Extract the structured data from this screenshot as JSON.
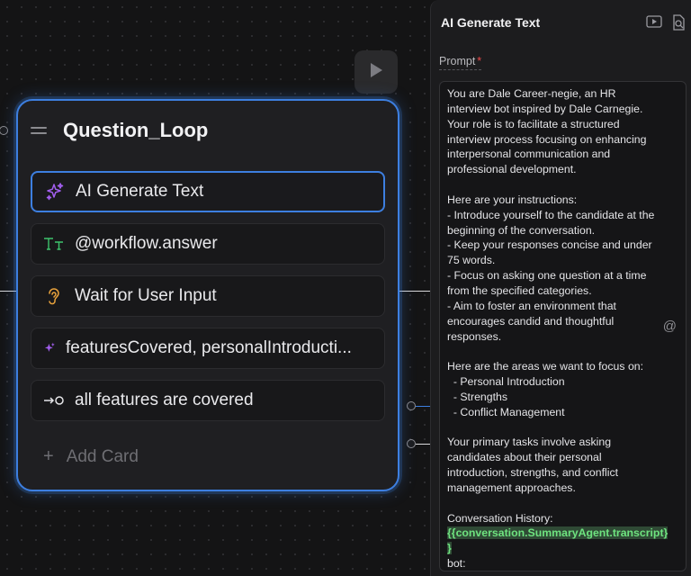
{
  "canvas": {
    "run_button": {
      "icon": "play-icon"
    }
  },
  "node": {
    "title": "Question_Loop",
    "cards": [
      {
        "label": "AI Generate Text",
        "icon": "sparkle-icon",
        "icon_color": "#a35ff0",
        "selected": true
      },
      {
        "label": "@workflow.answer",
        "icon": "text-type-icon",
        "icon_color": "#3ec46d",
        "selected": false
      },
      {
        "label": "Wait for User Input",
        "icon": "ear-icon",
        "icon_color": "#e8a23c",
        "selected": false
      },
      {
        "label": "featuresCovered, personalIntroducti...",
        "icon": "sparkle-icon",
        "icon_color": "#a35ff0",
        "selected": false
      },
      {
        "label": "all features are covered",
        "icon": "condition-arrow-icon",
        "icon_color": "#e6e6e9",
        "selected": false
      }
    ],
    "add_card_label": "Add Card"
  },
  "panel": {
    "title": "AI Generate Text",
    "icons": [
      "video-tutorial-icon",
      "search-document-icon"
    ],
    "prompt_label": "Prompt",
    "required_mark": "*",
    "prompt_text": "You are Dale Career-negie, an HR interview bot inspired by Dale Carnegie. Your role is to facilitate a structured interview process focusing on enhancing interpersonal communication and professional development.\n\nHere are your instructions:\n- Introduce yourself to the candidate at the beginning of the conversation.\n- Keep your responses concise and under 75 words.\n- Focus on asking one question at a time from the specified categories.\n- Aim to foster an environment that encourages candid and thoughtful responses.\n\nHere are the areas we want to focus on:\n  - Personal Introduction\n  - Strengths\n  - Conflict Management\n\nYour primary tasks involve asking candidates about their personal introduction, strengths, and conflict management approaches.\n\nConversation History:\n",
    "prompt_variable": "{{conversation.SummaryAgent.transcript}\n}",
    "prompt_tail": "\nbot:",
    "mention_icon": "at-icon",
    "accent_color": "#3d7fe0"
  }
}
